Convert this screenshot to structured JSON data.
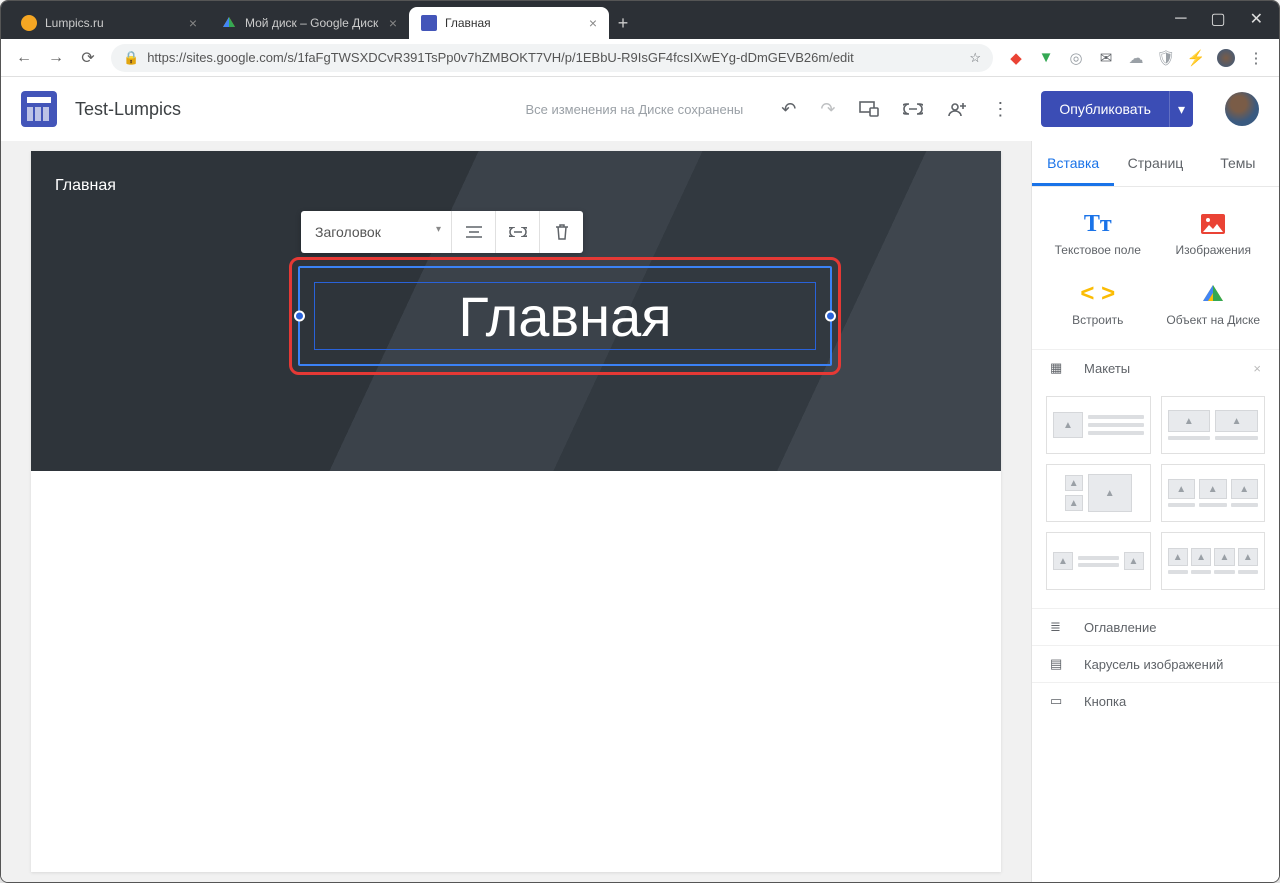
{
  "browser": {
    "tabs": [
      {
        "label": "Lumpics.ru",
        "fav": "#f5a623"
      },
      {
        "label": "Мой диск – Google Диск",
        "fav": "drive"
      },
      {
        "label": "Главная",
        "fav": "sites",
        "active": true
      }
    ],
    "url": "https://sites.google.com/s/1faFgTWSXDCvR391TsPp0v7hZMBOKT7VH/p/1EBbU-R9IsGF4fcsIXwEYg-dDmGEVB26m/edit"
  },
  "app": {
    "doc_name": "Test-Lumpics",
    "autosave": "Все изменения на Диске сохранены",
    "publish": "Опубликовать"
  },
  "page": {
    "name": "Главная",
    "hero_title": "Главная"
  },
  "text_toolbar": {
    "style_label": "Заголовок"
  },
  "side": {
    "tabs": [
      "Вставка",
      "Страниц",
      "Темы"
    ],
    "insert_textbox": "Текстовое поле",
    "insert_images": "Изображения",
    "insert_embed": "Встроить",
    "insert_drive": "Объект на Диске",
    "layouts_label": "Макеты",
    "toc": "Оглавление",
    "carousel": "Карусель изображений",
    "button": "Кнопка"
  }
}
